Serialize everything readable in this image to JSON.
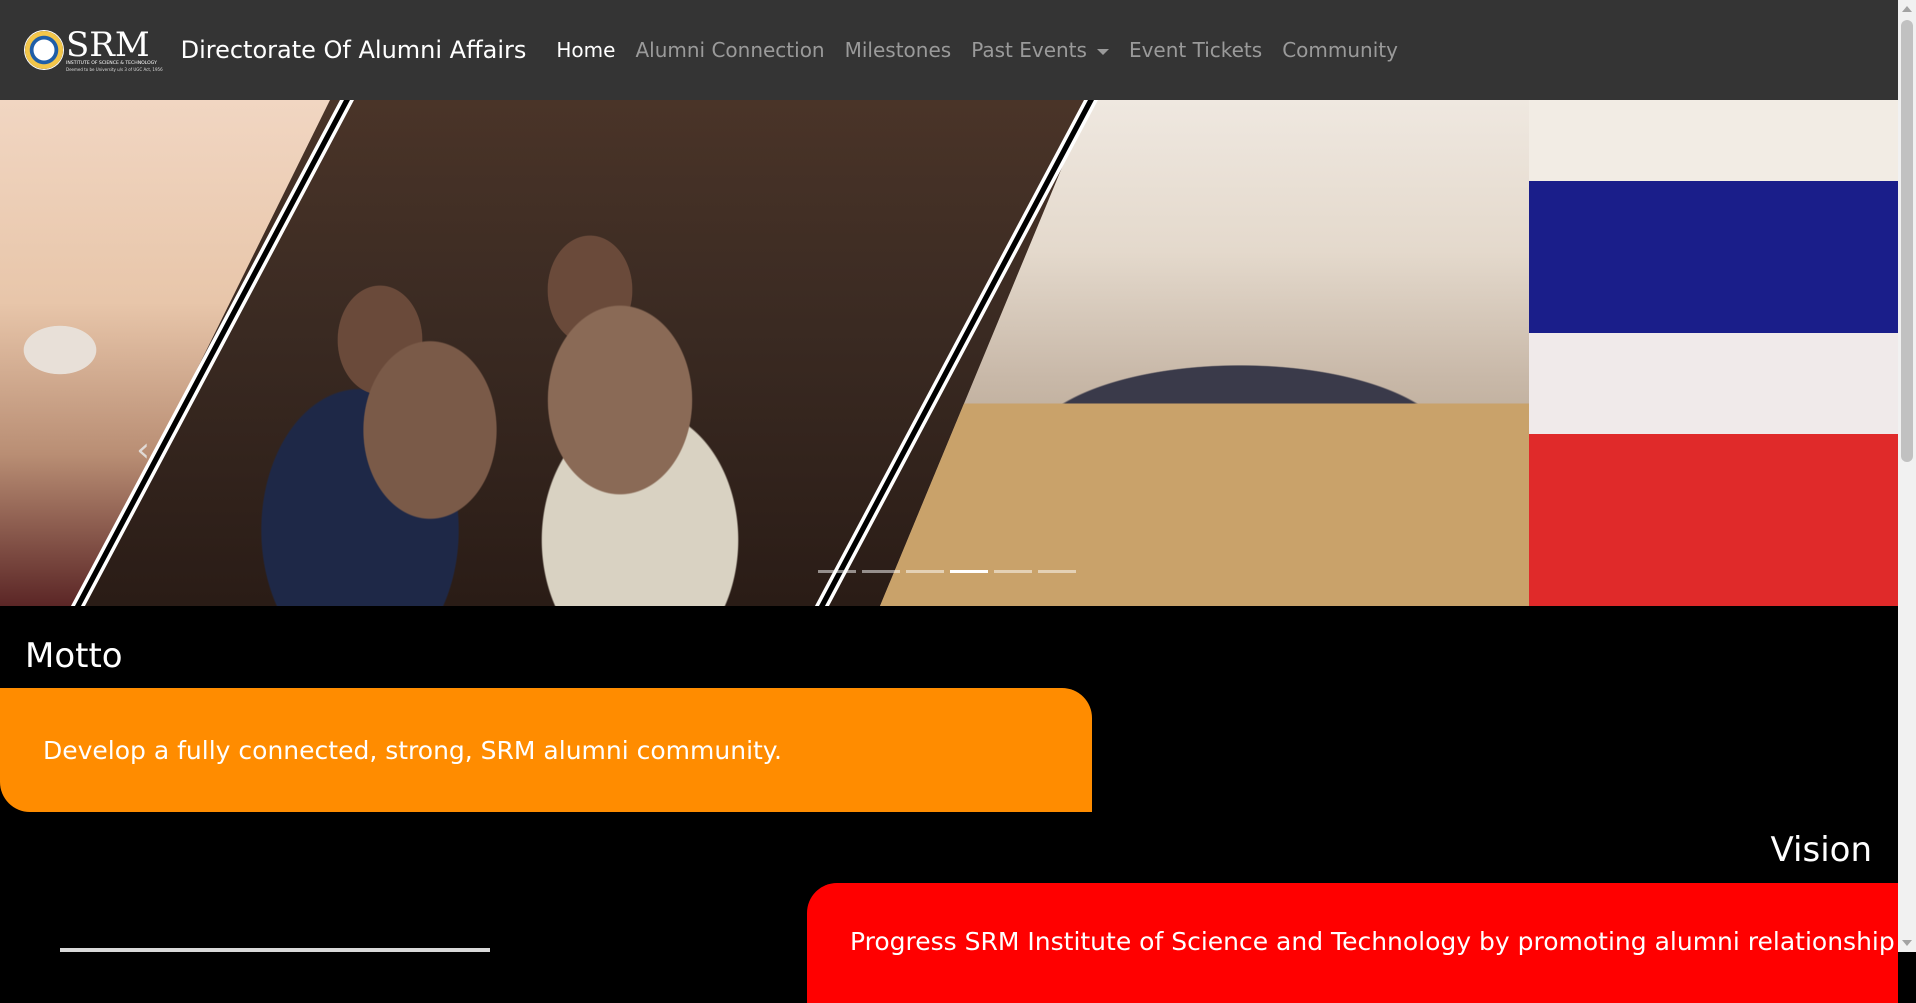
{
  "navbar": {
    "logo": {
      "word": "SRM",
      "sub1": "INSTITUTE OF SCIENCE & TECHNOLOGY",
      "sub2": "Deemed to be University u/s 3 of UGC Act, 1956"
    },
    "brand_title": "Directorate Of Alumni Affairs",
    "items": [
      {
        "label": "Home",
        "active": true
      },
      {
        "label": "Alumni Connection",
        "active": false
      },
      {
        "label": "Milestones",
        "active": false
      },
      {
        "label": "Past Events",
        "active": false,
        "dropdown": true
      },
      {
        "label": "Event Tickets",
        "active": false
      },
      {
        "label": "Community",
        "active": false
      }
    ]
  },
  "carousel": {
    "prev_icon": "chevron-left-icon",
    "slide_count": 6,
    "active_index": 3
  },
  "motto": {
    "title": "Motto",
    "text": "Develop a fully connected, strong, SRM alumni community."
  },
  "vision": {
    "title": "Vision",
    "text": "Progress SRM Institute of Science and Technology by promoting alumni relationship"
  },
  "colors": {
    "navbar_bg": "#343434",
    "page_bg": "#000000",
    "motto_bg": "#ff8c00",
    "vision_bg": "#ff0000"
  }
}
